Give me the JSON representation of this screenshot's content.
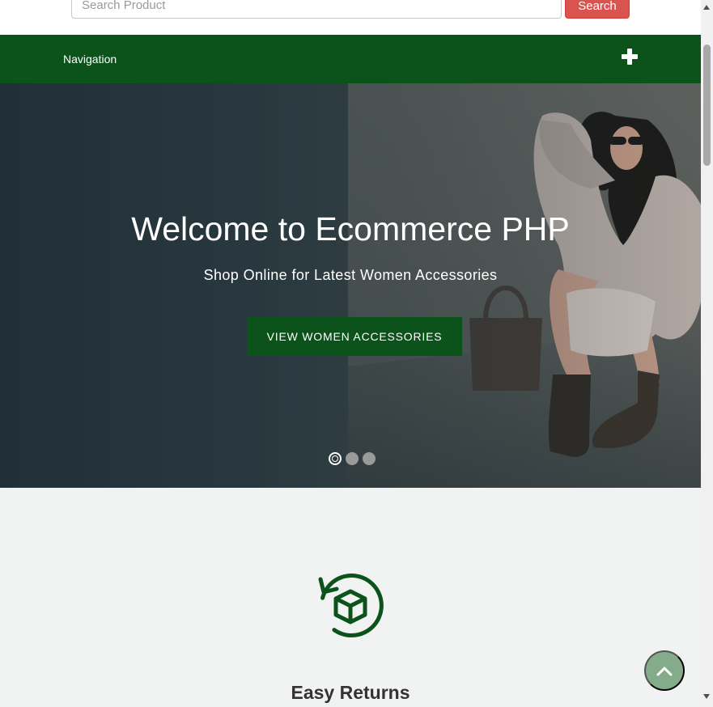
{
  "search": {
    "placeholder": "Search Product",
    "button_label": "Search"
  },
  "nav": {
    "title": "Navigation",
    "toggle_icon": "plus-icon"
  },
  "hero": {
    "title": "Welcome to Ecommerce PHP",
    "subtitle": "Shop Online for Latest Women Accessories",
    "button_label": "VIEW WOMEN ACCESSORIES",
    "slide_count": 3,
    "active_slide": 1
  },
  "features": {
    "items": [
      {
        "icon": "box-return-icon",
        "title": "Easy Returns"
      }
    ]
  },
  "colors": {
    "brand_green": "#0b531b",
    "search_red": "#d9534f",
    "back_to_top": "#84ac8a",
    "section_bg": "#f1f2f2"
  },
  "back_to_top": {
    "icon": "chevron-up-icon"
  }
}
